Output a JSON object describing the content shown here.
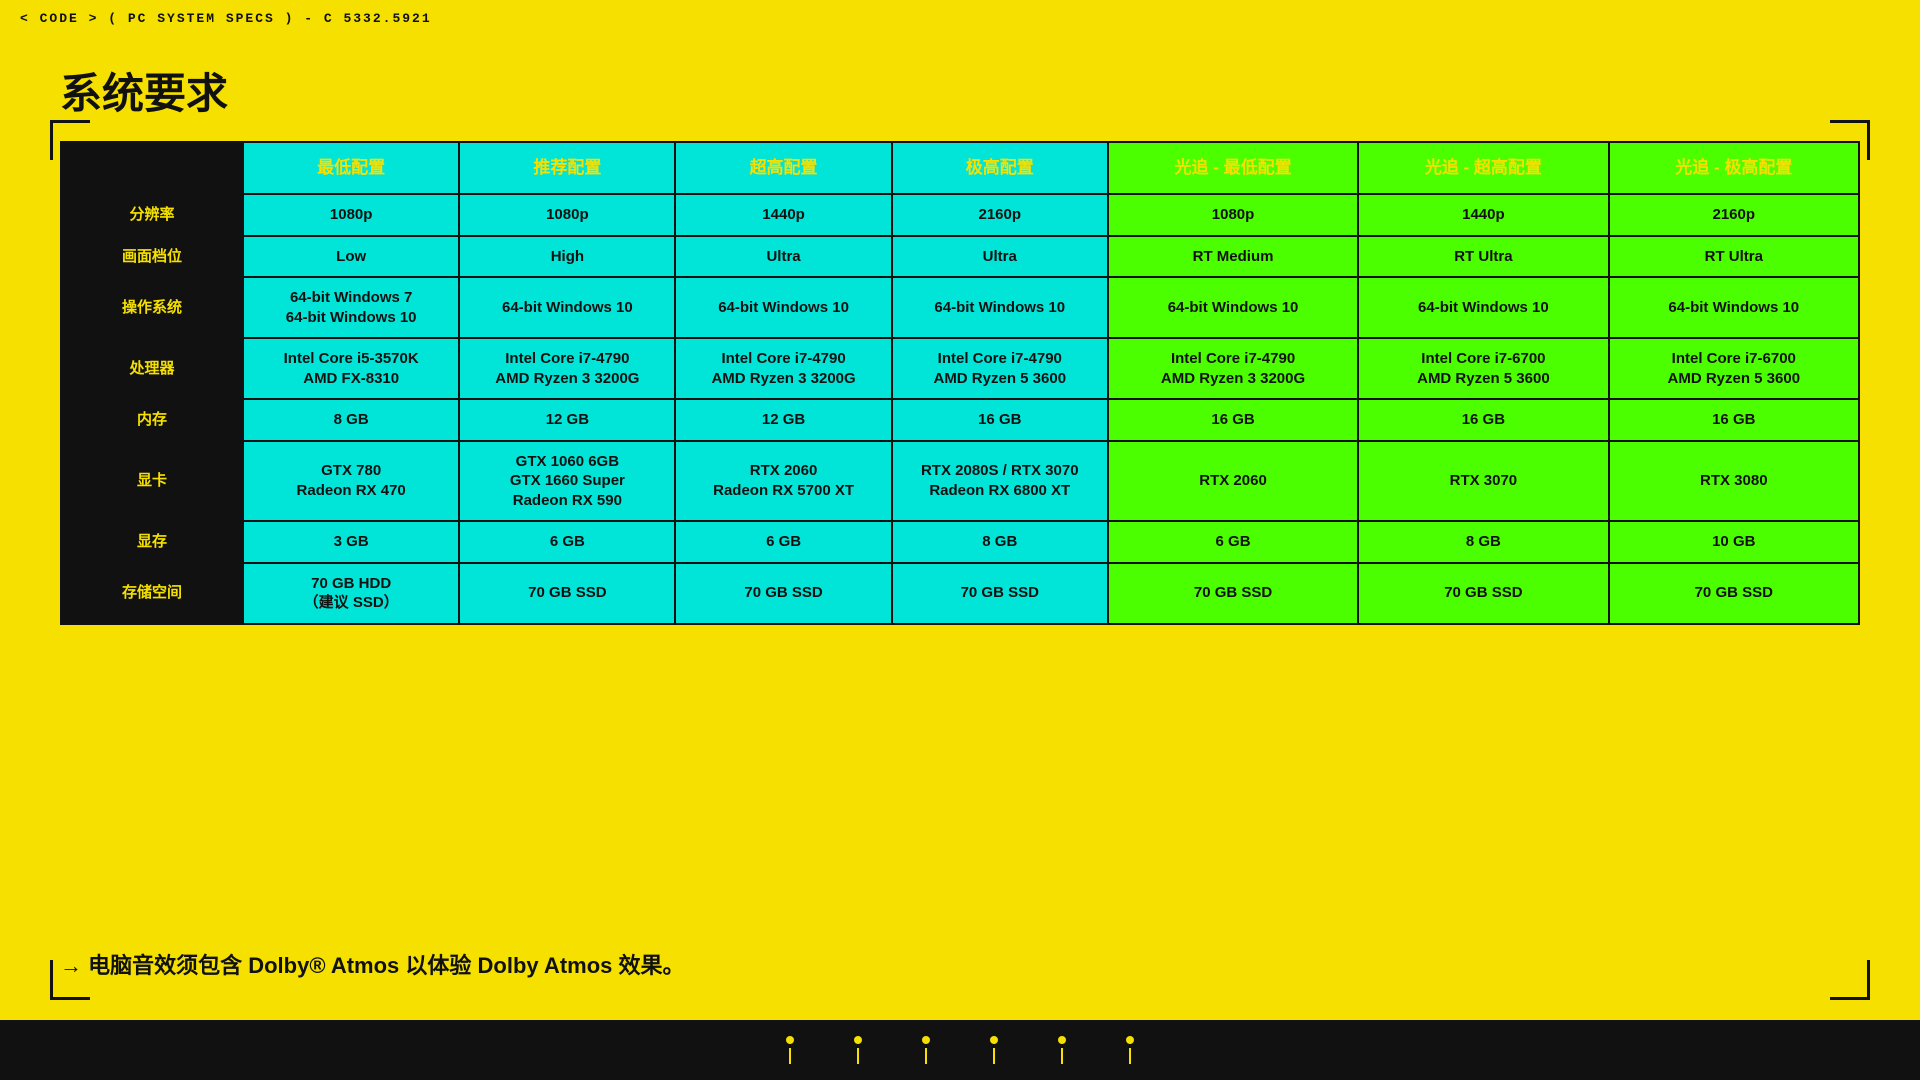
{
  "topbar": {
    "text": "< CODE > ( PC SYSTEM SPECS ) - C 5332.5921"
  },
  "title": "系统要求",
  "table": {
    "headers": {
      "empty": "",
      "col1": "最低配置",
      "col2": "推荐配置",
      "col3": "超高配置",
      "col4": "极高配置",
      "col5": "光追 - 最低配置",
      "col6": "光追 - 超高配置",
      "col7": "光追 - 极高配置"
    },
    "rows": [
      {
        "label": "分辨率",
        "c1": "1080p",
        "c2": "1080p",
        "c3": "1440p",
        "c4": "2160p",
        "c5": "1080p",
        "c6": "1440p",
        "c7": "2160p"
      },
      {
        "label": "画面档位",
        "c1": "Low",
        "c2": "High",
        "c3": "Ultra",
        "c4": "Ultra",
        "c5": "RT Medium",
        "c6": "RT Ultra",
        "c7": "RT Ultra"
      },
      {
        "label": "操作系统",
        "c1": "64-bit Windows 7\n64-bit Windows 10",
        "c2": "64-bit Windows 10",
        "c3": "64-bit Windows 10",
        "c4": "64-bit Windows 10",
        "c5": "64-bit Windows 10",
        "c6": "64-bit Windows 10",
        "c7": "64-bit Windows 10"
      },
      {
        "label": "处理器",
        "c1": "Intel Core i5-3570K\nAMD FX-8310",
        "c2": "Intel Core i7-4790\nAMD Ryzen 3 3200G",
        "c3": "Intel Core i7-4790\nAMD Ryzen 3 3200G",
        "c4": "Intel Core i7-4790\nAMD Ryzen 5 3600",
        "c5": "Intel Core i7-4790\nAMD Ryzen 3 3200G",
        "c6": "Intel Core i7-6700\nAMD Ryzen 5 3600",
        "c7": "Intel Core i7-6700\nAMD Ryzen 5 3600"
      },
      {
        "label": "内存",
        "c1": "8 GB",
        "c2": "12 GB",
        "c3": "12 GB",
        "c4": "16 GB",
        "c5": "16 GB",
        "c6": "16 GB",
        "c7": "16 GB"
      },
      {
        "label": "显卡",
        "c1": "GTX 780\nRadeon RX 470",
        "c2": "GTX 1060 6GB\nGTX 1660 Super\nRadeon RX 590",
        "c3": "RTX 2060\nRadeon RX 5700 XT",
        "c4": "RTX 2080S / RTX 3070\nRadeon RX 6800 XT",
        "c5": "RTX 2060",
        "c6": "RTX 3070",
        "c7": "RTX 3080"
      },
      {
        "label": "显存",
        "c1": "3 GB",
        "c2": "6 GB",
        "c3": "6 GB",
        "c4": "8 GB",
        "c5": "6 GB",
        "c6": "8 GB",
        "c7": "10 GB"
      },
      {
        "label": "存储空间",
        "c1": "70 GB HDD\n（建议 SSD）",
        "c2": "70 GB SSD",
        "c3": "70 GB SSD",
        "c4": "70 GB SSD",
        "c5": "70 GB SSD",
        "c6": "70 GB SSD",
        "c7": "70 GB SSD"
      }
    ]
  },
  "footer_note": "→ 电脑音效须包含 Dolby® Atmos 以体验 Dolby Atmos 效果。"
}
